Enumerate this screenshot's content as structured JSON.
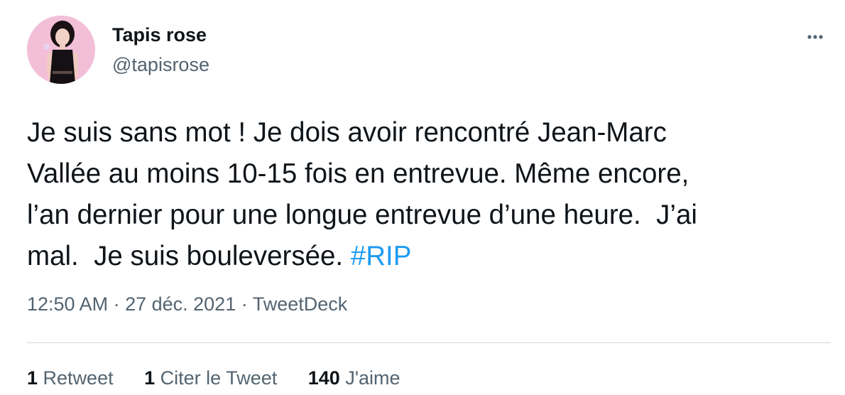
{
  "user": {
    "display_name": "Tapis rose",
    "handle": "@tapisrose",
    "avatar_icon": "profile-photo-avatar"
  },
  "more_icon": "more-horizontal-icon",
  "tweet": {
    "text_parts": [
      "Je suis sans mot ! Je dois avoir rencontré Jean-Marc\nVallée au moins 10-15 fois en entrevue. Même encore,\nl’an dernier pour une longue entrevue d’une heure.  J’ai\nmal.  Je suis bouleversée. "
    ],
    "hashtag": "#RIP",
    "hashtag_color": "#1d9bf0"
  },
  "meta": {
    "time": "12:50 AM",
    "sep1": " · ",
    "date": "27 déc. 2021",
    "sep2": " · ",
    "source": "TweetDeck"
  },
  "stats": {
    "retweets_count": "1",
    "retweets_label": "Retweet",
    "quotes_count": "1",
    "quotes_label": "Citer le Tweet",
    "likes_count": "140",
    "likes_label": "J'aime"
  },
  "colors": {
    "text": "#0f1419",
    "secondary": "#536471",
    "divider": "#cfd9de"
  }
}
